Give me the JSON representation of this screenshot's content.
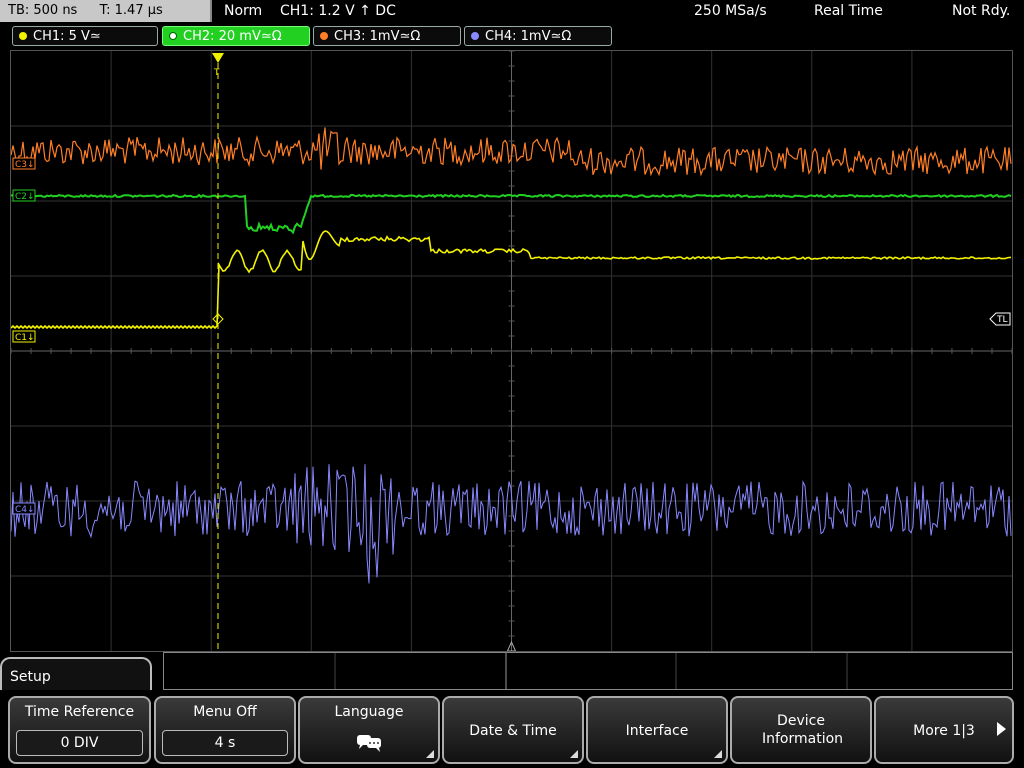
{
  "status_bar": {
    "timebase": "TB: 500 ns",
    "trigger_time": "T: 1.47 µs",
    "acq_mode": "Norm",
    "trigger_info": "CH1: 1.2 V ↑ DC",
    "sample_rate": "250 MSa/s",
    "acq_type": "Real Time",
    "ready_state": "Not Rdy."
  },
  "channels": [
    {
      "label": "CH1: 5 V≃",
      "color": "#f2f200",
      "active": false
    },
    {
      "label": "CH2: 20 mV≃Ω",
      "color": "#22d022",
      "active": true
    },
    {
      "label": "CH3: 1mV≃Ω",
      "color": "#ff7f27",
      "active": false
    },
    {
      "label": "CH4: 1mV≃Ω",
      "color": "#8888ff",
      "active": false
    }
  ],
  "markers": {
    "c1": "C1↓",
    "c2": "C2↓",
    "c3": "C3↓",
    "c4": "C4↓",
    "trigger_level": "TL",
    "trigger_pos": "T"
  },
  "menu": {
    "title": "Setup",
    "time_reference": {
      "label": "Time Reference",
      "value": "0 DIV"
    },
    "menu_off": {
      "label": "Menu Off",
      "value": "4 s"
    },
    "language": {
      "label": "Language"
    },
    "date_time": {
      "label": "Date & Time"
    },
    "interface": {
      "label": "Interface"
    },
    "device_info": {
      "label": "Device Information"
    },
    "more": {
      "label": "More 1|3"
    }
  },
  "icons": {
    "language": "speech-bubbles-icon",
    "more": "arrow-right-icon"
  }
}
